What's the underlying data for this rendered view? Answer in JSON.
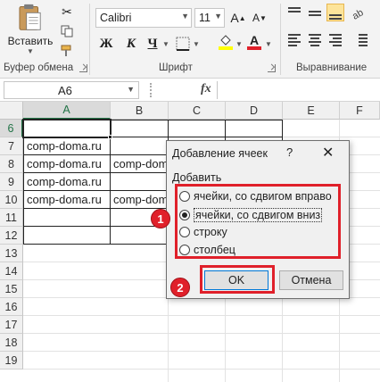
{
  "ribbon": {
    "clipboard": {
      "paste_label": "Вставить",
      "group_label": "Буфер обмена"
    },
    "font": {
      "name": "Calibri",
      "size": "11",
      "bold": "Ж",
      "italic": "К",
      "underline": "Ч",
      "font_color_letter": "A",
      "group_label": "Шрифт"
    },
    "alignment": {
      "group_label": "Выравнивание"
    }
  },
  "formula_bar": {
    "name_box": "A6",
    "fx": "fx",
    "formula": ""
  },
  "columns": [
    "A",
    "B",
    "C",
    "D",
    "E",
    "F"
  ],
  "rows": [
    "6",
    "7",
    "8",
    "9",
    "10",
    "11",
    "12",
    "13",
    "14",
    "15",
    "16",
    "17",
    "18",
    "19"
  ],
  "cells": {
    "a7": "comp-doma.ru",
    "a8": "comp-doma.ru",
    "b8": "comp-dom",
    "a9": "comp-doma.ru",
    "a10": "comp-doma.ru",
    "b10": "comp-dom"
  },
  "dialog": {
    "title": "Добавление ячеек",
    "help": "?",
    "close": "✕",
    "group_label": "Добавить",
    "options": [
      {
        "label": "ячейки, со сдвигом вправо",
        "selected": false
      },
      {
        "label": "ячейки, со сдвигом вниз",
        "selected": true
      },
      {
        "label": "строку",
        "selected": false
      },
      {
        "label": "столбец",
        "selected": false
      }
    ],
    "ok": "OK",
    "cancel": "Отмена"
  },
  "annotations": {
    "badge1": "1",
    "badge2": "2"
  },
  "colors": {
    "annotation_red": "#e0202a",
    "excel_green": "#217346",
    "ribbon_bg": "#f3f3f3"
  }
}
